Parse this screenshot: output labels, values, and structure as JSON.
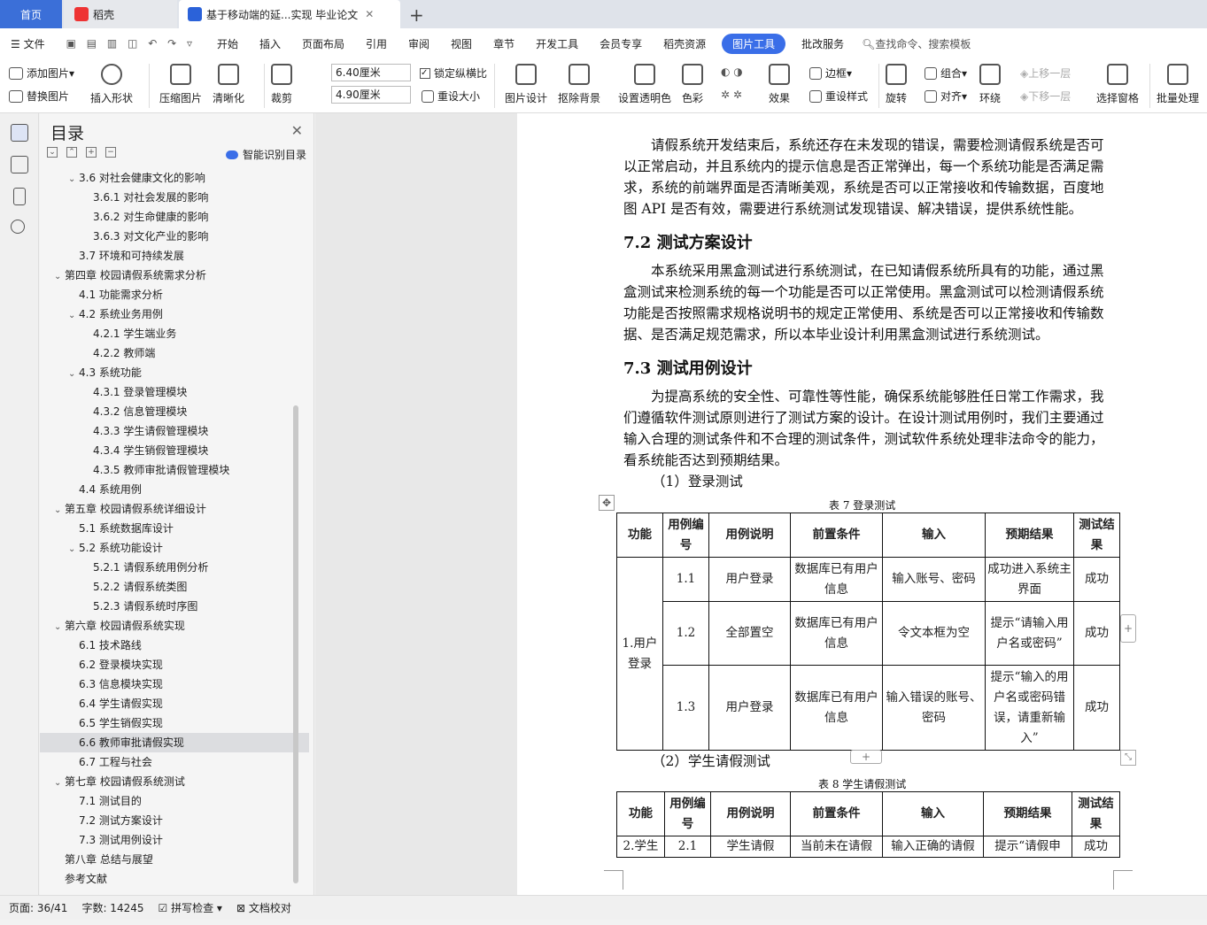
{
  "tabs": {
    "home": "首页",
    "daoke": "稻壳",
    "doc": "基于移动端的延...实现 毕业论文"
  },
  "menu": {
    "file": "文件",
    "items": [
      "开始",
      "插入",
      "页面布局",
      "引用",
      "审阅",
      "视图",
      "章节",
      "开发工具",
      "会员专享",
      "稻壳资源"
    ],
    "active": "图片工具",
    "after": "批改服务",
    "search": "查找命令、搜索模板"
  },
  "ribbon": {
    "add_image": "添加图片",
    "replace_image": "替换图片",
    "insert_shape": "插入形状",
    "compress": "压缩图片",
    "sharpen": "清晰化",
    "crop": "裁剪",
    "width": "6.40厘米",
    "height": "4.90厘米",
    "lock_ratio": "锁定纵横比",
    "reset_size": "重设大小",
    "design": "图片设计",
    "remove_bg": "抠除背景",
    "set_transparent": "设置透明色",
    "color": "色彩",
    "effect": "效果",
    "border": "边框",
    "reset_style": "重设样式",
    "rotate": "旋转",
    "group": "组合",
    "align": "对齐",
    "wrap": "环绕",
    "bring_forward": "上移一层",
    "send_backward": "下移一层",
    "select_pane": "选择窗格",
    "batch": "批量处理"
  },
  "outline": {
    "title": "目录",
    "smart": "智能识别目录",
    "items": [
      {
        "t": "3.6  对社会健康文化的影响",
        "lvl": 1,
        "arrow": true
      },
      {
        "t": "3.6.1  对社会发展的影响",
        "lvl": 2
      },
      {
        "t": "3.6.2  对生命健康的影响",
        "lvl": 2
      },
      {
        "t": "3.6.3  对文化产业的影响",
        "lvl": 2
      },
      {
        "t": "3.7  环境和可持续发展",
        "lvl": 1
      },
      {
        "t": "第四章  校园请假系统需求分析",
        "lvl": 0,
        "arrow": true
      },
      {
        "t": "4.1  功能需求分析",
        "lvl": 1
      },
      {
        "t": "4.2  系统业务用例",
        "lvl": 1,
        "arrow": true
      },
      {
        "t": "4.2.1  学生端业务",
        "lvl": 2
      },
      {
        "t": "4.2.2  教师端",
        "lvl": 2
      },
      {
        "t": "4.3  系统功能",
        "lvl": 1,
        "arrow": true
      },
      {
        "t": "4.3.1  登录管理模块",
        "lvl": 2
      },
      {
        "t": "4.3.2  信息管理模块",
        "lvl": 2
      },
      {
        "t": "4.3.3  学生请假管理模块",
        "lvl": 2
      },
      {
        "t": "4.3.4  学生销假管理模块",
        "lvl": 2
      },
      {
        "t": "4.3.5  教师审批请假管理模块",
        "lvl": 2
      },
      {
        "t": "4.4  系统用例",
        "lvl": 1
      },
      {
        "t": "第五章  校园请假系统详细设计",
        "lvl": 0,
        "arrow": true
      },
      {
        "t": "5.1  系统数据库设计",
        "lvl": 1
      },
      {
        "t": "5.2  系统功能设计",
        "lvl": 1,
        "arrow": true
      },
      {
        "t": "5.2.1  请假系统用例分析",
        "lvl": 2
      },
      {
        "t": "5.2.2  请假系统类图",
        "lvl": 2
      },
      {
        "t": "5.2.3  请假系统时序图",
        "lvl": 2
      },
      {
        "t": "第六章  校园请假系统实现",
        "lvl": 0,
        "arrow": true
      },
      {
        "t": "6.1  技术路线",
        "lvl": 1
      },
      {
        "t": "6.2  登录模块实现",
        "lvl": 1
      },
      {
        "t": "6.3  信息模块实现",
        "lvl": 1
      },
      {
        "t": "6.4  学生请假实现",
        "lvl": 1
      },
      {
        "t": "6.5  学生销假实现",
        "lvl": 1
      },
      {
        "t": "6.6  教师审批请假实现",
        "lvl": 1,
        "selected": true
      },
      {
        "t": "6.7  工程与社会",
        "lvl": 1
      },
      {
        "t": "第七章  校园请假系统测试",
        "lvl": 0,
        "arrow": true
      },
      {
        "t": "7.1  测试目的",
        "lvl": 1
      },
      {
        "t": "7.2  测试方案设计",
        "lvl": 1
      },
      {
        "t": "7.3  测试用例设计",
        "lvl": 1
      },
      {
        "t": "第八章  总结与展望",
        "lvl": 0
      },
      {
        "t": "参考文献",
        "lvl": 0
      }
    ]
  },
  "doc": {
    "p1": "请假系统开发结束后，系统还存在未发现的错误，需要检测请假系统是否可以正常启动，并且系统内的提示信息是否正常弹出，每一个系统功能是否满足需求，系统的前端界面是否清晰美观，系统是否可以正常接收和传输数据，百度地图 API 是否有效，需要进行系统测试发现错误、解决错误，提供系统性能。",
    "h72": "7.2  测试方案设计",
    "p2": "本系统采用黑盒测试进行系统测试，在已知请假系统所具有的功能，通过黑盒测试来检测系统的每一个功能是否可以正常使用。黑盒测试可以检测请假系统功能是否按照需求规格说明书的规定正常使用、系统是否可以正常接收和传输数据、是否满足规范需求，所以本毕业设计利用黑盒测试进行系统测试。",
    "h73": "7.3  测试用例设计",
    "p3": "为提高系统的安全性、可靠性等性能，确保系统能够胜任日常工作需求，我们遵循软件测试原则进行了测试方案的设计。在设计测试用例时，我们主要通过输入合理的测试条件和不合理的测试条件，测试软件系统处理非法命令的能力，看系统能否达到预期结果。",
    "sub1": "（1）登录测试",
    "cap7": "表 7  登录测试",
    "sub2": "（2）学生请假测试",
    "cap8": "表 8  学生请假测试",
    "headers": [
      "功能",
      "用例编号",
      "用例说明",
      "前置条件",
      "输入",
      "预期结果",
      "测试结果"
    ],
    "t7_func": "1.用户登录",
    "t7_rows": [
      [
        "1.1",
        "用户登录",
        "数据库已有用户信息",
        "输入账号、密码",
        "成功进入系统主界面",
        "成功"
      ],
      [
        "1.2",
        "全部置空",
        "数据库已有用户信息",
        "令文本框为空",
        "提示“请输入用户名或密码”",
        "成功"
      ],
      [
        "1.3",
        "用户登录",
        "数据库已有用户信息",
        "输入错误的账号、密码",
        "提示“输入的用户名或密码错误，请重新输入”",
        "成功"
      ]
    ],
    "t8_row": [
      "2.学生",
      "2.1",
      "学生请假",
      "当前未在请假",
      "输入正确的请假",
      "提示“请假申",
      "成功"
    ]
  },
  "status": {
    "page": "页面: 36/41",
    "words": "字数: 14245",
    "spell": "拼写检查",
    "proof": "文档校对"
  }
}
